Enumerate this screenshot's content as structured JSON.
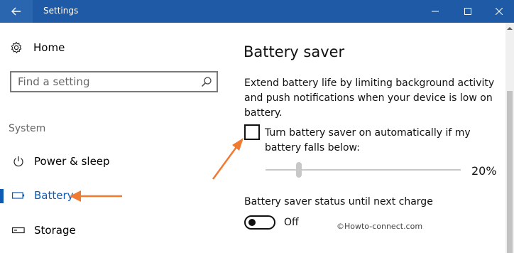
{
  "window": {
    "title": "Settings",
    "controls": {
      "back_icon": "arrow-left-icon",
      "minimize_icon": "minimize-icon",
      "maximize_icon": "maximize-icon",
      "close_icon": "close-icon"
    },
    "titlebar_color": "#1e5aa6"
  },
  "sidebar": {
    "home_label": "Home",
    "home_icon": "gear-icon",
    "search": {
      "placeholder": "Find a setting",
      "icon": "search-icon"
    },
    "section_title": "System",
    "items": [
      {
        "label": "Power & sleep",
        "icon": "power-icon",
        "active": false
      },
      {
        "label": "Battery",
        "icon": "battery-icon",
        "active": true
      },
      {
        "label": "Storage",
        "icon": "storage-icon",
        "active": false
      }
    ],
    "accent_color": "#0f5ab3"
  },
  "main": {
    "title": "Battery saver",
    "description": "Extend battery life by limiting background activity and push notifications when your device is low on battery.",
    "auto_checkbox": {
      "label": "Turn battery saver on automatically if my battery falls below:",
      "checked": false
    },
    "threshold_slider": {
      "value_label": "20%",
      "value": 20
    },
    "status": {
      "label": "Battery saver status until next charge",
      "toggle_state": "Off",
      "on": false
    }
  },
  "watermark": "©Howto-connect.com",
  "annotation_color": "#f07a30"
}
